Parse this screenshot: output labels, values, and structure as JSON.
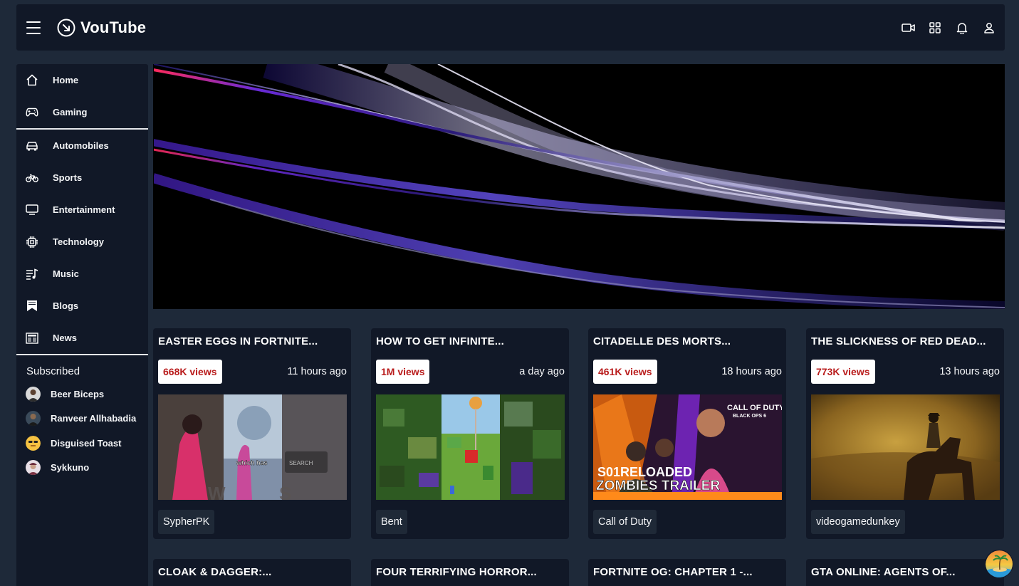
{
  "app": {
    "name": "VouTube"
  },
  "header": {
    "icons": [
      "menu-icon",
      "logo-icon",
      "video-camera-icon",
      "apps-grid-icon",
      "bell-icon",
      "user-icon"
    ]
  },
  "sidebar": {
    "items": [
      {
        "label": "Home",
        "icon": "home-icon"
      },
      {
        "label": "Gaming",
        "icon": "gamepad-icon"
      },
      {
        "label": "Automobiles",
        "icon": "car-icon"
      },
      {
        "label": "Sports",
        "icon": "bicycle-icon"
      },
      {
        "label": "Entertainment",
        "icon": "tv-icon"
      },
      {
        "label": "Technology",
        "icon": "chip-icon"
      },
      {
        "label": "Music",
        "icon": "music-icon"
      },
      {
        "label": "Blogs",
        "icon": "bookmark-icon"
      },
      {
        "label": "News",
        "icon": "newspaper-icon"
      }
    ],
    "subscribed_title": "Subscribed",
    "subscriptions": [
      {
        "name": "Beer Biceps"
      },
      {
        "name": "Ranveer Allhabadia"
      },
      {
        "name": "Disguised Toast"
      },
      {
        "name": "Sykkuno"
      }
    ]
  },
  "videos": [
    {
      "title": "EASTER EGGS IN FORTNITE...",
      "views": "668K views",
      "time": "11 hours ago",
      "channel": "SypherPK",
      "thumb_text": "which has"
    },
    {
      "title": "HOW TO GET INFINITE...",
      "views": "1M views",
      "time": "a day ago",
      "channel": "Bent"
    },
    {
      "title": "CITADELLE DES MORTS...",
      "views": "461K views",
      "time": "18 hours ago",
      "channel": "Call of Duty",
      "thumb_text_1": "S01RELOADED",
      "thumb_text_2": "ZOMBIES TRAILER",
      "thumb_logo_1": "CALL OF DUTY",
      "thumb_logo_2": "BLACK OPS 6"
    },
    {
      "title": "THE SLICKNESS OF RED DEAD...",
      "views": "773K views",
      "time": "13 hours ago",
      "channel": "videogamedunkey"
    }
  ],
  "videos_row2": [
    {
      "title": "CLOAK & DAGGER:..."
    },
    {
      "title": "FOUR TERRIFYING HORROR..."
    },
    {
      "title": "FORTNITE OG: CHAPTER 1 -..."
    },
    {
      "title": "GTA ONLINE: AGENTS OF..."
    }
  ],
  "colors": {
    "background": "#1e2939",
    "panel": "#111827",
    "views_text": "#b91c1c",
    "chip": "#1f2937"
  }
}
